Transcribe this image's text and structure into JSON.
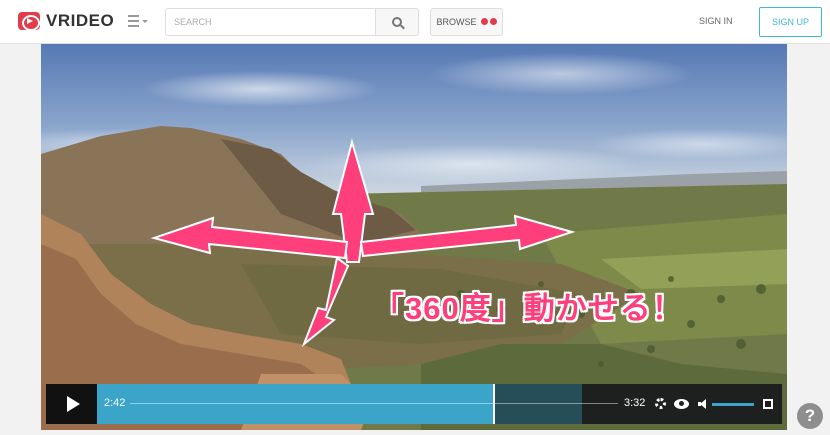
{
  "header": {
    "logo_text": "VRIDEO",
    "search_placeholder": "SEARCH",
    "browse_label": "BROWSE",
    "signin_label": "SIGN IN",
    "signup_label": "SIGN UP"
  },
  "overlay": {
    "caption": "「360度」動かせる！"
  },
  "player": {
    "current_time": "2:42",
    "total_time": "3:32",
    "progress": 0.76,
    "volume": 1.0
  },
  "help": {
    "label": "?"
  },
  "colors": {
    "brand": "#e23b4a",
    "accent": "#3aa5c8",
    "arrow": "#ff3f7b"
  }
}
